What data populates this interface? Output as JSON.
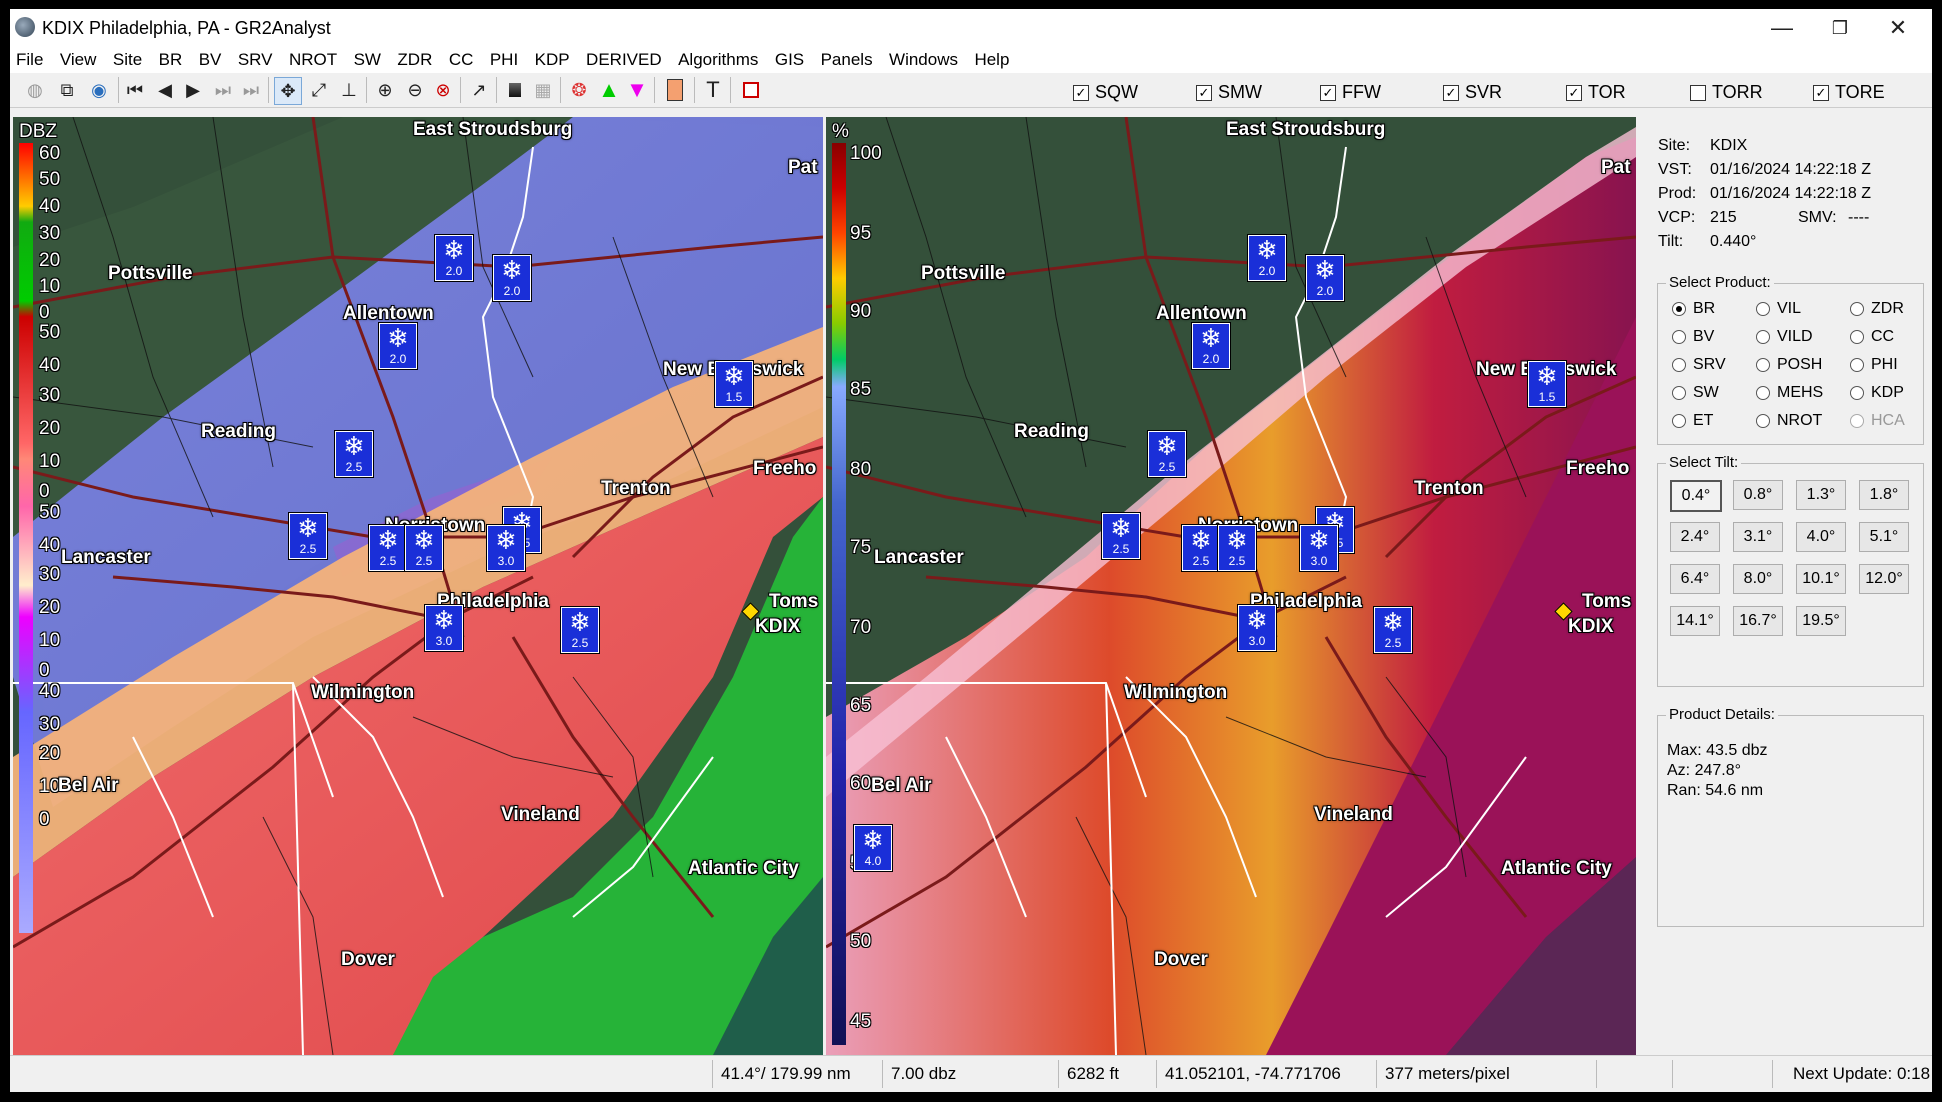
{
  "window": {
    "title": "KDIX Philadelphia, PA - GR2Analyst"
  },
  "menu": [
    "File",
    "View",
    "Site",
    "BR",
    "BV",
    "SRV",
    "NROT",
    "SW",
    "ZDR",
    "CC",
    "PHI",
    "KDP",
    "DERIVED",
    "Algorithms",
    "GIS",
    "Panels",
    "Windows",
    "Help"
  ],
  "warnings": [
    {
      "label": "SQW",
      "checked": true
    },
    {
      "label": "SMW",
      "checked": true
    },
    {
      "label": "FFW",
      "checked": true
    },
    {
      "label": "SVR",
      "checked": true
    },
    {
      "label": "TOR",
      "checked": true
    },
    {
      "label": "TORR",
      "checked": false
    },
    {
      "label": "TORE",
      "checked": true
    }
  ],
  "left_panel": {
    "unit": "DBZ",
    "scale_labels": [
      "60",
      "50",
      "40",
      "30",
      "20",
      "10",
      "0",
      "50",
      "40",
      "30",
      "20",
      "10",
      "0",
      "50",
      "40",
      "30",
      "20",
      "10",
      "0",
      "40",
      "30",
      "20",
      "10",
      "0"
    ]
  },
  "right_panel": {
    "unit": "%",
    "scale_labels": [
      "100",
      "95",
      "90",
      "85",
      "80",
      "75",
      "70",
      "65",
      "60",
      "55",
      "50",
      "45"
    ]
  },
  "cities": {
    "east_stroudsburg": "East Stroudsburg",
    "pottsville": "Pottsville",
    "allentown": "Allentown",
    "new_brunswick": "New Brunswick",
    "reading": "Reading",
    "trenton": "Trenton",
    "freehold": "Freeho",
    "lancaster": "Lancaster",
    "norristown": "Norristown",
    "philadelphia": "Philadelphia",
    "toms": "Toms",
    "kdix": "KDIX",
    "wilmington": "Wilmington",
    "bel_air": "Bel Air",
    "vineland": "Vineland",
    "atlantic_city": "Atlantic City",
    "dover": "Dover",
    "pat": "Pat"
  },
  "snow_reports": [
    "2.0",
    "2.0",
    "2.0",
    "1.5",
    "2.5",
    "2.5",
    "2.5",
    "2.5",
    "2.5",
    "3.0",
    "2.5",
    "3.0",
    "2.5",
    "4.0"
  ],
  "site_info": {
    "site": {
      "k": "Site:",
      "v": "KDIX"
    },
    "vst": {
      "k": "VST:",
      "v": "01/16/2024  14:22:18 Z"
    },
    "prod": {
      "k": "Prod:",
      "v": "01/16/2024  14:22:18 Z"
    },
    "vcp": {
      "k": "VCP:",
      "v": "215"
    },
    "smv": {
      "k": "SMV:",
      "v": "----"
    },
    "tilt": {
      "k": "Tilt:",
      "v": "0.440°"
    }
  },
  "select_product": {
    "title": "Select Product:",
    "options": [
      "BR",
      "VIL",
      "ZDR",
      "BV",
      "VILD",
      "CC",
      "SRV",
      "POSH",
      "PHI",
      "SW",
      "MEHS",
      "KDP",
      "ET",
      "NROT",
      "HCA"
    ],
    "selected": "BR"
  },
  "select_tilt": {
    "title": "Select Tilt:",
    "tilts": [
      "0.4°",
      "0.8°",
      "1.3°",
      "1.8°",
      "2.4°",
      "3.1°",
      "4.0°",
      "5.1°",
      "6.4°",
      "8.0°",
      "10.1°",
      "12.0°",
      "14.1°",
      "16.7°",
      "19.5°"
    ],
    "selected": "0.4°"
  },
  "product_details": {
    "title": "Product Details:",
    "max": "Max:  43.5 dbz",
    "az": "Az:   247.8°",
    "ran": "Ran:  54.6 nm"
  },
  "status_bar": {
    "azran": "41.4°/ 179.99 nm",
    "value": "7.00 dbz",
    "height": "6282 ft",
    "latlon": "41.052101, -74.771706",
    "res": "377 meters/pixel",
    "next": "Next Update: 0:18"
  },
  "colors": {
    "snow_blue": "#1a2fd8",
    "site_marker": "#ffd700",
    "map_base": "#2f4a34"
  }
}
